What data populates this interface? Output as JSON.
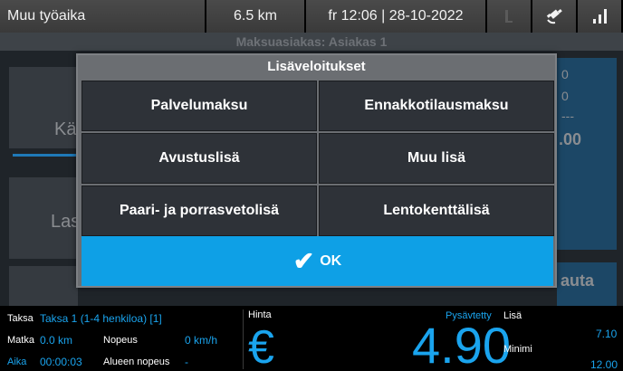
{
  "status_bar": {
    "title": "Muu työaika",
    "distance": "6.5 km",
    "datetime": "fr 12:06 | 28-10-2022",
    "icons": [
      "phone-icon",
      "gps-icon",
      "signal-icon"
    ]
  },
  "background": {
    "header": "Maksuasiakas: Asiakas 1",
    "tile_left_top": "Kä",
    "tile_left_mid": "Las",
    "tile_right_top_1": "0",
    "tile_right_top_2": "0",
    "tile_right_dashes": "---",
    "tile_right_value": ".00",
    "tile_right_bottom": "auta"
  },
  "dialog": {
    "title": "Lisäveloitukset",
    "options": [
      "Palvelumaksu",
      "Ennakkotilausmaksu",
      "Avustuslisä",
      "Muu lisä",
      "Paari- ja porrasvetolisä",
      "Lentokenttälisä"
    ],
    "ok_label": "OK"
  },
  "bottom": {
    "taksa_label": "Taksa",
    "taksa_value": "Taksa 1 (1-4 henkiloa) [1]",
    "matka_label": "Matka",
    "matka_value": "0.0 km",
    "nopeus_label": "Nopeus",
    "nopeus_value": "0 km/h",
    "aika_label": "Aika",
    "aika_value": "00:00:03",
    "alueen_label": "Alueen nopeus",
    "alueen_value": "-",
    "hinta_label": "Hinta",
    "currency": "€",
    "price": "4.90",
    "pysavtetty": "Pysävtetty",
    "lisa_label": "Lisä",
    "minimi_label": "Minimi",
    "right_top": "7.10",
    "right_bottom": "12.00"
  },
  "colors": {
    "accent": "#1aa4ee",
    "ok_button": "#0ea0e6",
    "dialog_bg": "#6b6e72",
    "option_bg": "#2e3238"
  }
}
